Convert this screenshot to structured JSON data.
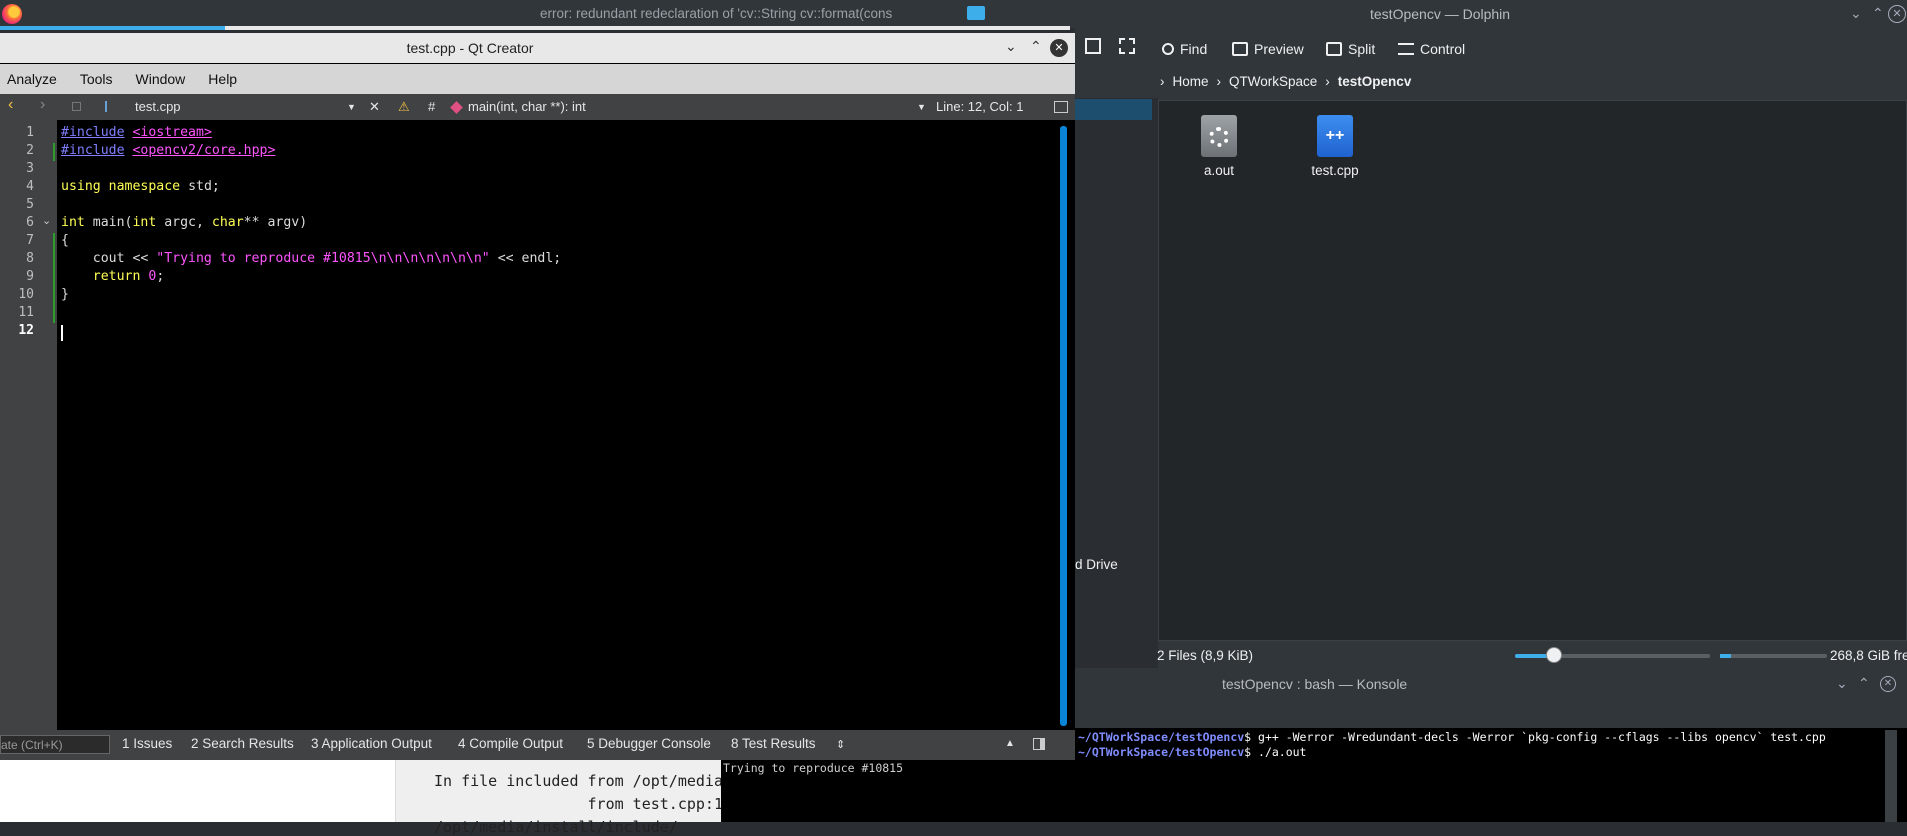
{
  "firefox": {
    "title": "error: redundant redeclaration of 'cv::String cv::format(cons"
  },
  "dolphin": {
    "title": "testOpencv — Dolphin",
    "toolbar": {
      "find": "Find",
      "preview": "Preview",
      "split": "Split",
      "control": "Control"
    },
    "breadcrumb": [
      "Home",
      "QTWorkSpace",
      "testOpencv"
    ],
    "places_partial": "d Drive",
    "files": [
      {
        "name": "a.out",
        "icon": "gear-file-icon"
      },
      {
        "name": "test.cpp",
        "icon": "cpp-file-icon",
        "glyph": "++"
      }
    ],
    "status": "2 Files (8,9 KiB)",
    "free_space": "268,8 GiB fre",
    "zoom_fraction": 0.2,
    "space_used_fraction": 0.1
  },
  "konsole": {
    "title": "testOpencv : bash — Konsole",
    "lines": [
      {
        "prompt": "~/QTWorkSpace/testOpencv",
        "command": "$ g++ -Werror -Wredundant-decls -Werror `pkg-config --cflags --libs opencv` test.cpp"
      },
      {
        "prompt": "~/QTWorkSpace/testOpencv",
        "command": "$ ./a.out"
      }
    ]
  },
  "qtcreator": {
    "title": "test.cpp - Qt Creator",
    "menu": [
      "Analyze",
      "Tools",
      "Window",
      "Help"
    ],
    "editbar": {
      "file": "test.cpp",
      "hash": "#",
      "symbol": "main(int, char **): int",
      "position": "Line: 12, Col: 1"
    },
    "line_numbers": [
      "1",
      "2",
      "3",
      "4",
      "5",
      "6",
      "7",
      "8",
      "9",
      "10",
      "11",
      "12"
    ],
    "code": {
      "l1_dir": "#include",
      "l1_arg": "<iostream>",
      "l2_dir": "#include",
      "l2_arg": "<opencv2/core.hpp>",
      "l4_kw1": "using",
      "l4_kw2": "namespace",
      "l4_rest": " std;",
      "l6_kw1": "int",
      "l6_a": " main(",
      "l6_kw2": "int",
      "l6_b": " argc, ",
      "l6_kw3": "char",
      "l6_c": "** argv)",
      "l7": "{",
      "l8_a": "    cout << ",
      "l8_str": "\"Trying to reproduce #10815\\n\\n\\n\\n\\n\\n\\n\"",
      "l8_b": " << endl;",
      "l9_kw": "    return",
      "l9_sp": " ",
      "l9_num": "0",
      "l9_end": ";",
      "l10": "}"
    },
    "locator_placeholder": "ate (Ctrl+K)",
    "output_tabs": [
      "1  Issues",
      "2  Search Results",
      "3  Application Output",
      "4  Compile Output",
      "5  Debugger Console",
      "8  Test Results"
    ],
    "compile_output": [
      "In file included from /opt/media",
      "                 from test.cpp:1",
      "/opt/media/install/include/"
    ],
    "app_output": "Trying to reproduce #10815"
  }
}
